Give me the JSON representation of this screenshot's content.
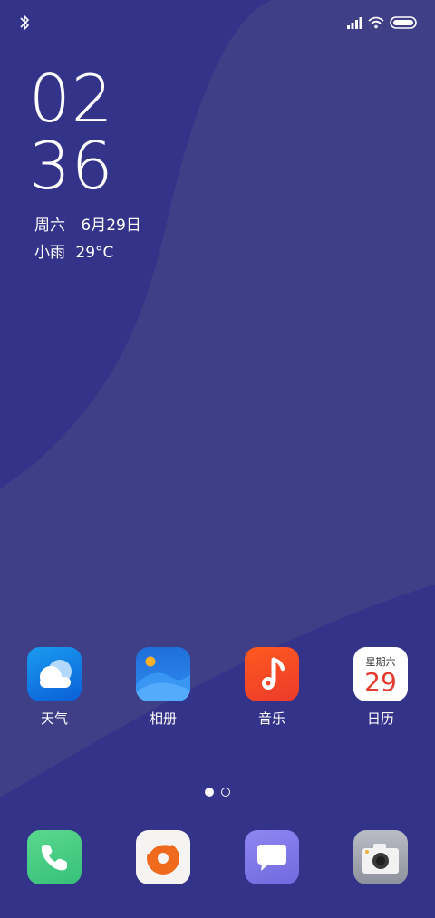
{
  "status_bar": {
    "bluetooth_icon": "bluetooth-icon",
    "signal_icon": "signal-icon",
    "wifi_icon": "wifi-icon",
    "battery_icon": "battery-icon"
  },
  "clock": {
    "hours": "02",
    "minutes": "36"
  },
  "date": {
    "weekday": "周六",
    "date": "6月29日"
  },
  "weather": {
    "condition": "小雨",
    "temperature": "29°C"
  },
  "apps": [
    {
      "label": "天气",
      "icon": "weather-icon"
    },
    {
      "label": "相册",
      "icon": "gallery-icon"
    },
    {
      "label": "音乐",
      "icon": "music-icon"
    },
    {
      "label": "日历",
      "icon": "calendar-icon",
      "weekday": "星期六",
      "day": "29"
    }
  ],
  "page_indicator": {
    "current": 1,
    "total": 2
  },
  "dock": [
    {
      "icon": "phone-icon"
    },
    {
      "icon": "browser-icon"
    },
    {
      "icon": "messages-icon"
    },
    {
      "icon": "camera-icon"
    }
  ],
  "colors": {
    "wallpaper_dark": "#33338a",
    "wallpaper_light": "#3e3f86"
  }
}
